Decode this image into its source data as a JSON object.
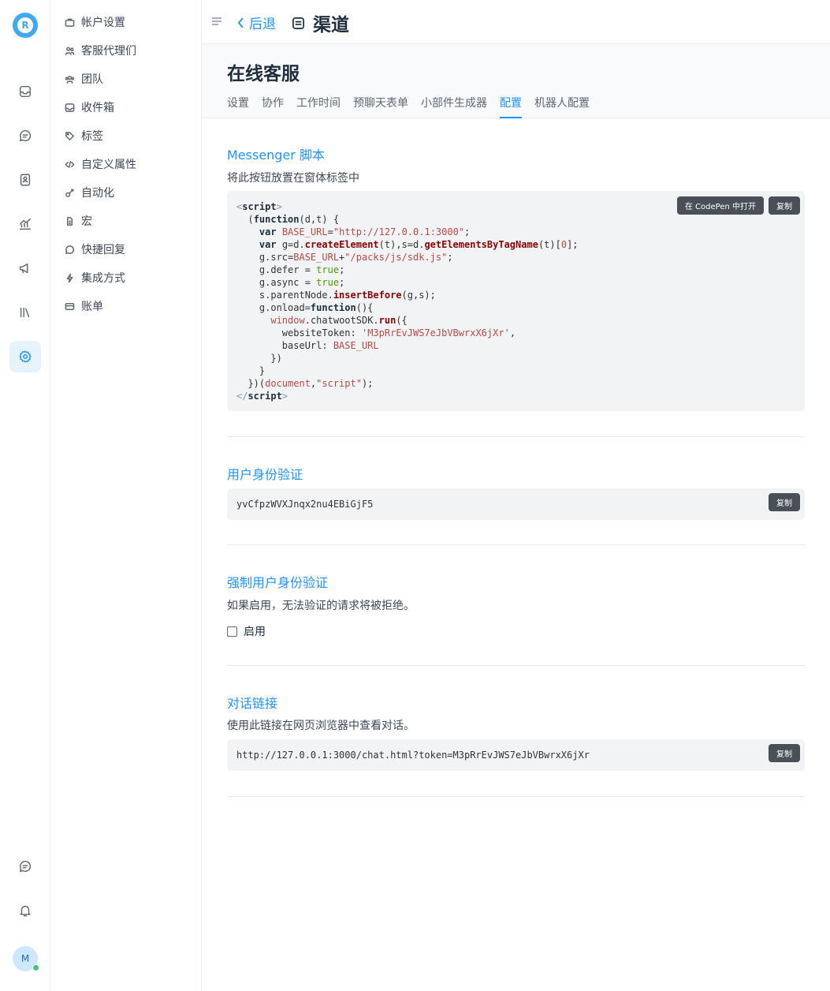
{
  "brand": {
    "logo_letter": "R",
    "accent": "#1f93ff"
  },
  "rail": {
    "icons": [
      "inbox-icon",
      "conversations-icon",
      "contacts-icon",
      "reports-icon",
      "campaigns-icon",
      "library-icon",
      "settings-icon"
    ],
    "bottom": [
      "chat-icon",
      "bell-icon"
    ],
    "avatar_letter": "M",
    "status_color": "#44c27a"
  },
  "sidebar": {
    "items": [
      {
        "label": "帐户设置",
        "icon": "briefcase-icon"
      },
      {
        "label": "客服代理们",
        "icon": "people-icon"
      },
      {
        "label": "团队",
        "icon": "team-icon"
      },
      {
        "label": "收件箱",
        "icon": "inbox-icon"
      },
      {
        "label": "标签",
        "icon": "tag-icon"
      },
      {
        "label": "自定义属性",
        "icon": "code-icon"
      },
      {
        "label": "自动化",
        "icon": "automation-icon"
      },
      {
        "label": "宏",
        "icon": "macro-icon"
      },
      {
        "label": "快捷回复",
        "icon": "reply-icon"
      },
      {
        "label": "集成方式",
        "icon": "integration-icon"
      },
      {
        "label": "账单",
        "icon": "billing-icon"
      }
    ]
  },
  "header": {
    "back_label": "后退",
    "title": "渠道"
  },
  "inbox": {
    "name": "在线客服",
    "tabs": [
      "设置",
      "协作",
      "工作时间",
      "预聊天表单",
      "小部件生成器",
      "配置",
      "机器人配置"
    ],
    "active_tab": "配置"
  },
  "messenger": {
    "title": "Messenger 脚本",
    "desc": "将此按钮放置在窗体标签中",
    "codepen_button": "在 CodePen 中打开",
    "copy_button": "复制",
    "base_url": "http://127.0.0.1:3000",
    "sdk_path": "/packs/js/sdk.js",
    "website_token": "M3pRrEvJWS7eJbVBwrxX6jXr"
  },
  "hmac": {
    "title": "用户身份验证",
    "token": "yvCfpzWVXJnqx2nu4EBiGjF5",
    "copy_button": "复制"
  },
  "enforce": {
    "title": "强制用户身份验证",
    "desc": "如果启用，无法验证的请求将被拒绝。",
    "checkbox_label": "启用",
    "checked": false
  },
  "link": {
    "title": "对话链接",
    "desc": "使用此链接在网页浏览器中查看对话。",
    "url": "http://127.0.0.1:3000/chat.html?token=M3pRrEvJWS7eJbVBwrxX6jXr",
    "copy_button": "复制"
  }
}
